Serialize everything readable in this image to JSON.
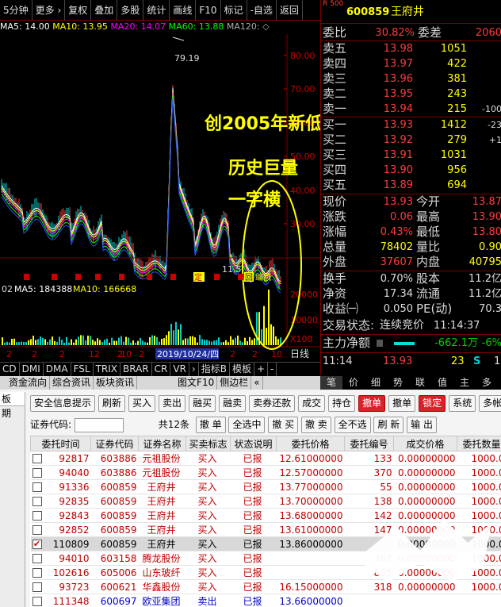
{
  "toolbar": {
    "items": [
      "5分钟",
      "更多 ›",
      "复权",
      "叠加",
      "多股",
      "统计",
      "画线",
      "F10",
      "标记",
      "-自选",
      "返回"
    ]
  },
  "ma_row": {
    "prefix": "MA5: 14.00",
    "ma10": "MA10: 13.95",
    "ma20": "MA20: 14.07",
    "ma60": "MA60: 13.88",
    "ma120": "MA120: ◇"
  },
  "axis": {
    "price_ticks": [
      "80.00",
      "70.00",
      "60.00",
      "50.00",
      "40.00",
      "30.00"
    ],
    "vol_ticks": [
      "20000",
      "10000",
      "X100"
    ],
    "date_label": "2019/10/24/四",
    "day_label": "日线"
  },
  "chart_labels": {
    "peak": "79.19",
    "low": "11.5",
    "box_icons": [
      "定",
      "回",
      "编额"
    ]
  },
  "volume_row": {
    "left": "02",
    "ma5": "MA5: 184388",
    "ma10": "MA10: 166668"
  },
  "annotations": {
    "line1": "创2005年新低",
    "line2": "历史巨量",
    "line3": "一字横"
  },
  "x_ticks": [
    "2",
    "2",
    "2",
    "12",
    "2",
    "2",
    "2",
    "10",
    "2",
    "2",
    "10"
  ],
  "indicator_tabs": [
    "CD",
    "DMI",
    "DMA",
    "FSL",
    "TRIX",
    "BRAR",
    "CR",
    "VR",
    "›",
    "指标B",
    "模板",
    "+",
    "-"
  ],
  "quote": {
    "badge": "R 500",
    "code": "600859",
    "name": "王府井",
    "weibi_label": "委比",
    "weibi": "30.82%",
    "weicha_label": "委差",
    "weicha": "2060",
    "asks": [
      {
        "label": "卖五",
        "price": "13.98",
        "vol": "1051",
        "chg": ""
      },
      {
        "label": "卖四",
        "price": "13.97",
        "vol": "422",
        "chg": ""
      },
      {
        "label": "卖三",
        "price": "13.96",
        "vol": "381",
        "chg": ""
      },
      {
        "label": "卖二",
        "price": "13.95",
        "vol": "243",
        "chg": ""
      },
      {
        "label": "卖一",
        "price": "13.94",
        "vol": "215",
        "chg": "-100"
      }
    ],
    "bids": [
      {
        "label": "买一",
        "price": "13.93",
        "vol": "1412",
        "chg": "-23"
      },
      {
        "label": "买二",
        "price": "13.92",
        "vol": "279",
        "chg": "+1"
      },
      {
        "label": "买三",
        "price": "13.91",
        "vol": "1031",
        "chg": ""
      },
      {
        "label": "买四",
        "price": "13.90",
        "vol": "956",
        "chg": ""
      },
      {
        "label": "买五",
        "price": "13.89",
        "vol": "694",
        "chg": ""
      }
    ],
    "stats": [
      {
        "l1": "现价",
        "v1": "13.93",
        "l2": "今开",
        "v2": "13.87"
      },
      {
        "l1": "涨跌",
        "v1": "0.06",
        "l2": "最高",
        "v2": "13.90"
      },
      {
        "l1": "涨幅",
        "v1": "0.43%",
        "l2": "最低",
        "v2": "13.80"
      },
      {
        "l1": "总量",
        "v1": "78402",
        "l2": "量比",
        "v2": "0.90"
      },
      {
        "l1": "外盘",
        "v1": "37607",
        "l2": "内盘",
        "v2": "40795"
      }
    ],
    "stats2": [
      {
        "l1": "换手",
        "v1": "0.70%",
        "l2": "股本",
        "v2": "11.2亿"
      },
      {
        "l1": "净资",
        "v1": "17.34",
        "l2": "流通",
        "v2": "11.2亿"
      },
      {
        "l1": "收益㈠",
        "v1": "0.050",
        "l2": "PE(动)",
        "v2": "70.3"
      }
    ],
    "trade_status_label": "交易状态:",
    "trade_status": "连续竞价",
    "trade_time": "11:14:37",
    "main_flow_label": "主力净额",
    "main_flow": "-662.1万",
    "main_flow_pct": "-6%",
    "tick": {
      "time": "11:14",
      "price": "13.93",
      "vol": "23",
      "side": "S",
      "count": "1"
    }
  },
  "bottom_tabs_left": [
    "资金流向",
    "综合资讯",
    "板块资讯",
    "图文F10",
    "侧边栏",
    "«"
  ],
  "bottom_tabs_right": [
    "笔",
    "价",
    "细",
    "势",
    "联",
    "值",
    "主",
    "多"
  ],
  "sidebar": {
    "items": [
      "板",
      "期"
    ]
  },
  "buttons": [
    "安全信息提示",
    "刷新",
    "买入",
    "卖出",
    "融买",
    "融卖",
    "卖券还款",
    "成交",
    "持仓",
    "撤单",
    "撤单",
    "锁定",
    "系统",
    "多帐号"
  ],
  "filter": {
    "label": "证券代码:",
    "count": "共12条",
    "b1": "撤 单",
    "b2": "全选中",
    "b3": "撤 买",
    "b4": "撤 卖",
    "b5": "全不选",
    "b6": "刷 新",
    "b7": "输 出"
  },
  "table": {
    "headers": [
      "委托时间",
      "证券代码",
      "证券名称",
      "买卖标志",
      "状态说明",
      "委托价格",
      "委托编号",
      "成交价格",
      "委托数量"
    ],
    "rows": [
      {
        "checked": false,
        "time": "92817",
        "code": "603886",
        "name": "元祖股份",
        "side": "买入",
        "status": "已报",
        "price": "12.61000000",
        "no": "133",
        "deal": "0.00000000",
        "qty": "1000.0"
      },
      {
        "checked": false,
        "time": "94040",
        "code": "603886",
        "name": "元祖股份",
        "side": "买入",
        "status": "已报",
        "price": "12.57000000",
        "no": "370",
        "deal": "0.00000000",
        "qty": "1000.0"
      },
      {
        "checked": false,
        "time": "91336",
        "code": "600859",
        "name": "王府井",
        "side": "买入",
        "status": "已报",
        "price": "13.77000000",
        "no": "55",
        "deal": "0.00000000",
        "qty": "1000.0"
      },
      {
        "checked": false,
        "time": "92835",
        "code": "600859",
        "name": "王府井",
        "side": "买入",
        "status": "已报",
        "price": "13.70000000",
        "no": "138",
        "deal": "0.00000000",
        "qty": "1000.0"
      },
      {
        "checked": false,
        "time": "92843",
        "code": "600859",
        "name": "王府井",
        "side": "买入",
        "status": "已报",
        "price": "13.68000000",
        "no": "142",
        "deal": "0.00000000",
        "qty": "1000.0"
      },
      {
        "checked": false,
        "time": "92852",
        "code": "600859",
        "name": "王府井",
        "side": "买入",
        "status": "已报",
        "price": "13.61000000",
        "no": "147",
        "deal": "0.00000000",
        "qty": "1000.0"
      },
      {
        "checked": true,
        "time": "110809",
        "code": "600859",
        "name": "王府井",
        "side": "买入",
        "status": "已报",
        "price": "13.86000000",
        "no": "",
        "deal": "0.00000000",
        "qty": "1000.0"
      },
      {
        "checked": false,
        "time": "94010",
        "code": "603158",
        "name": "腾龙股份",
        "side": "买入",
        "status": "已报",
        "price": "",
        "no": "362",
        "deal": "0.00000000",
        "qty": "1000.0"
      },
      {
        "checked": false,
        "time": "102616",
        "code": "605006",
        "name": "山东玻纤",
        "side": "买入",
        "status": "已报",
        "price": "",
        "no": "805",
        "deal": "0.00000000",
        "qty": "1000.0"
      },
      {
        "checked": false,
        "time": "93723",
        "code": "600621",
        "name": "华鑫股份",
        "side": "买入",
        "status": "已报",
        "price": "16.15000000",
        "no": "318",
        "deal": "0.00000000",
        "qty": "1000.0"
      },
      {
        "checked": false,
        "time": "111348",
        "code": "600697",
        "name": "欧亚集团",
        "side": "卖出",
        "status": "已报",
        "price": "13.66000000",
        "no": "",
        "deal": "",
        "qty": ""
      }
    ]
  },
  "colors": {
    "up": "#ff3b3b",
    "down": "#00d000",
    "ma5": "#ffffff",
    "ma10": "#ffff00",
    "ma20": "#ff00ff",
    "ma60": "#00ff00",
    "ma120": "#2a4cff",
    "annot": "#ffff00"
  }
}
